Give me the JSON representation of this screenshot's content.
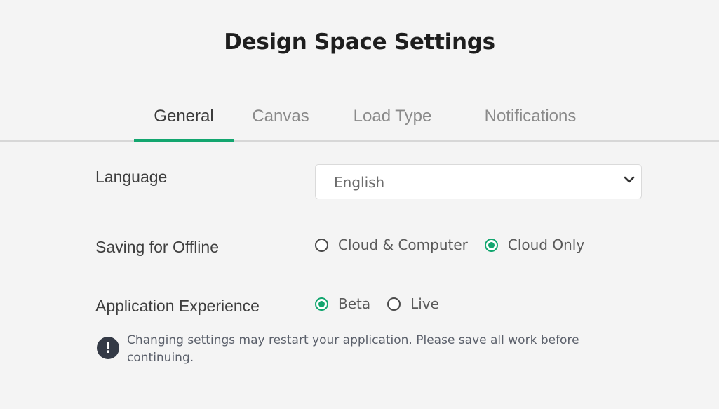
{
  "header": {
    "title": "Design Space Settings"
  },
  "tabs": [
    {
      "label": "General",
      "active": true
    },
    {
      "label": "Canvas",
      "active": false
    },
    {
      "label": "Load Type",
      "active": false
    },
    {
      "label": "Notifications",
      "active": false
    }
  ],
  "settings": {
    "language": {
      "label": "Language",
      "value": "English"
    },
    "saving_offline": {
      "label": "Saving for Offline",
      "options": [
        {
          "label": "Cloud & Computer",
          "checked": false
        },
        {
          "label": "Cloud Only",
          "checked": true
        }
      ]
    },
    "app_experience": {
      "label": "Application Experience",
      "options": [
        {
          "label": "Beta",
          "checked": true
        },
        {
          "label": "Live",
          "checked": false
        }
      ]
    }
  },
  "notice": {
    "icon": "exclamation-icon",
    "text": "Changing settings may restart your application. Please save all work before continuing."
  },
  "colors": {
    "accent": "#13a66f",
    "background": "#f4f4f4",
    "notice_icon": "#343a46"
  }
}
